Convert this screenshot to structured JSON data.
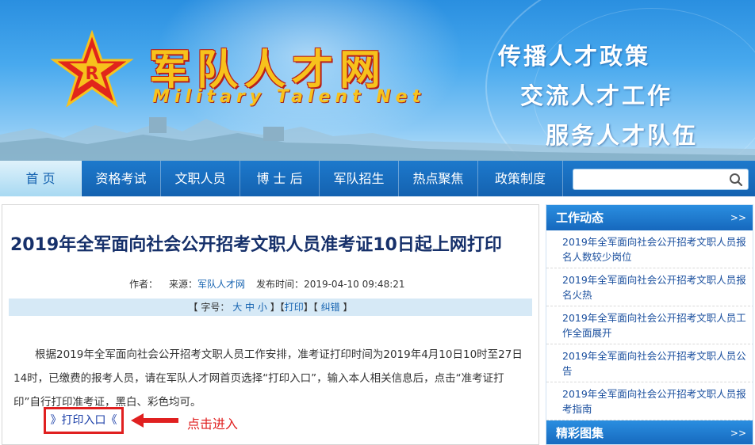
{
  "banner": {
    "logo_cn": "军队人才网",
    "logo_en": "Military Talent Net",
    "slogans": [
      "传播人才政策",
      "交流人才工作",
      "服务人才队伍"
    ]
  },
  "nav": {
    "items": [
      "首 页",
      "资格考试",
      "文职人员",
      "博 士 后",
      "军队招生",
      "热点聚焦",
      "政策制度"
    ],
    "active_index": 0,
    "search_placeholder": ""
  },
  "article": {
    "title": "2019年全军面向社会公开招考文职人员准考证10日起上网打印",
    "meta": {
      "author_label": "作者：",
      "source_label": "来源：",
      "source_value": "军队人才网",
      "time_label": "发布时间：",
      "time_value": "2019-04-10 09:48:21"
    },
    "toolbar": {
      "open1": "【",
      "font_size_label": "字号：",
      "size_large": "大",
      "size_medium": "中",
      "size_small": "小",
      "close1": "】【",
      "print": "打印",
      "close2": "】【",
      "correct": "纠错",
      "close3": "】"
    },
    "body": "根据2019年全军面向社会公开招考文职人员工作安排，准考证打印时间为2019年4月10日10时至27日14时，已缴费的报考人员，请在军队人才网首页选择“打印入口”，输入本人相关信息后，点击“准考证打印”自行打印准考证，黑白、彩色均可。",
    "print_entry": "》打印入口《",
    "click_hint": "点击进入"
  },
  "sidebar": {
    "section1_title": "工作动态",
    "section1_more": ">>",
    "items": [
      "2019年全军面向社会公开招考文职人员报名人数较少岗位",
      "2019年全军面向社会公开招考文职人员报名火热",
      "2019年全军面向社会公开招考文职人员工作全面展开",
      "2019年全军面向社会公开招考文职人员公告",
      "2019年全军面向社会公开招考文职人员报考指南"
    ],
    "section2_title": "精彩图集",
    "section2_more": ">>"
  },
  "colors": {
    "nav_blue": "#1462b0",
    "title_navy": "#16306a",
    "highlight_red": "#e02020",
    "logo_gold": "#f7c21c"
  }
}
